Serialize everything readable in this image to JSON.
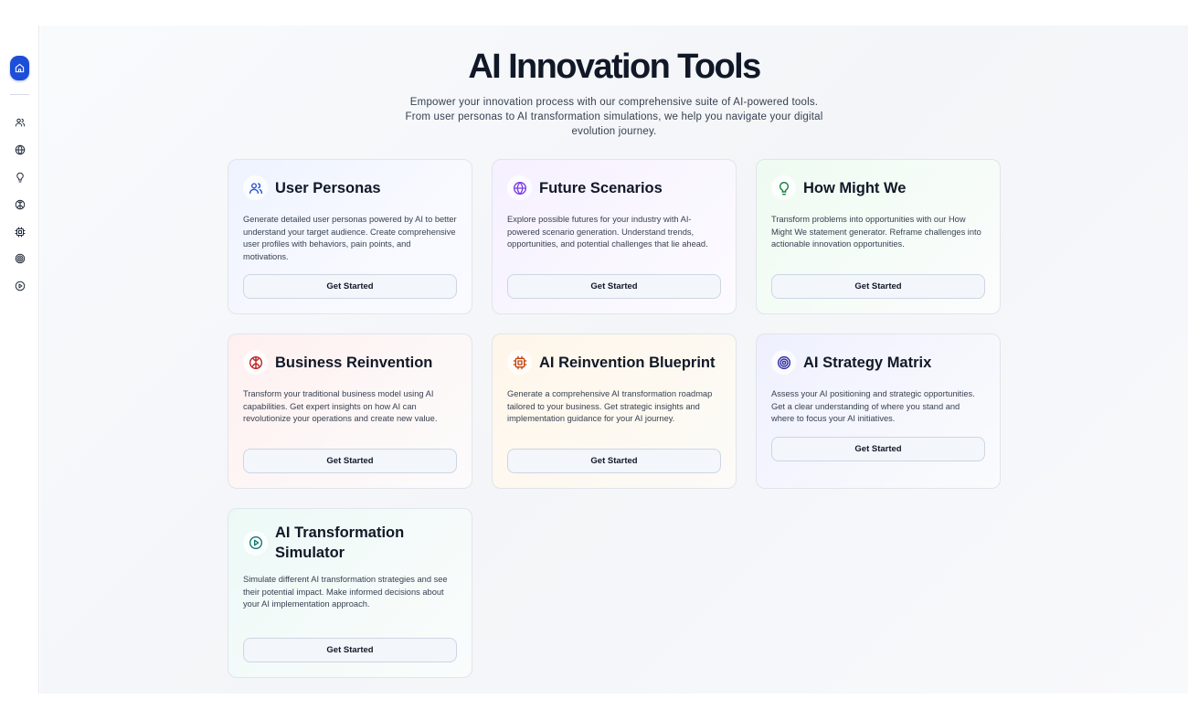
{
  "page": {
    "title": "AI Innovation Tools",
    "subtitle": "Empower your innovation process with our comprehensive suite of AI-powered tools. From user personas to AI transformation simulations, we help you navigate your digital evolution journey."
  },
  "sidebar": {
    "items": [
      {
        "icon": "home-icon",
        "active": true
      },
      {
        "icon": "users-icon"
      },
      {
        "icon": "globe-icon"
      },
      {
        "icon": "lightbulb-icon"
      },
      {
        "icon": "brain-icon"
      },
      {
        "icon": "cpu-icon"
      },
      {
        "icon": "target-icon"
      },
      {
        "icon": "play-circle-icon"
      }
    ]
  },
  "cards": [
    {
      "title": "User Personas",
      "description": "Generate detailed user personas powered by AI to better understand your target audience. Create comprehensive user profiles with behaviors, pain points, and motivations.",
      "button": "Get Started",
      "icon": "users-icon",
      "color": "#1d4ed8"
    },
    {
      "title": "Future Scenarios",
      "description": "Explore possible futures for your industry with AI-powered scenario generation. Understand trends, opportunities, and potential challenges that lie ahead.",
      "button": "Get Started",
      "icon": "globe-icon",
      "color": "#7c3aed"
    },
    {
      "title": "How Might We",
      "description": "Transform problems into opportunities with our How Might We statement generator. Reframe challenges into actionable innovation opportunities.",
      "button": "Get Started",
      "icon": "lightbulb-icon",
      "color": "#15803d"
    },
    {
      "title": "Business Reinvention",
      "description": "Transform your traditional business model using AI capabilities. Get expert insights on how AI can revolutionize your operations and create new value.",
      "button": "Get Started",
      "icon": "brain-icon",
      "color": "#b91c1c"
    },
    {
      "title": "AI Reinvention Blueprint",
      "description": "Generate a comprehensive AI transformation roadmap tailored to your business. Get strategic insights and implementation guidance for your AI journey.",
      "button": "Get Started",
      "icon": "cpu-icon",
      "color": "#c2410c"
    },
    {
      "title": "AI Strategy Matrix",
      "description": "Assess your AI positioning and strategic opportunities. Get a clear understanding of where you stand and where to focus your AI initiatives.",
      "button": "Get Started",
      "icon": "target-icon",
      "color": "#3730a3"
    },
    {
      "title": "AI Transformation Simulator",
      "description": "Simulate different AI transformation strategies and see their potential impact. Make informed decisions about your AI implementation approach.",
      "button": "Get Started",
      "icon": "play-circle-icon",
      "color": "#0f766e"
    }
  ]
}
